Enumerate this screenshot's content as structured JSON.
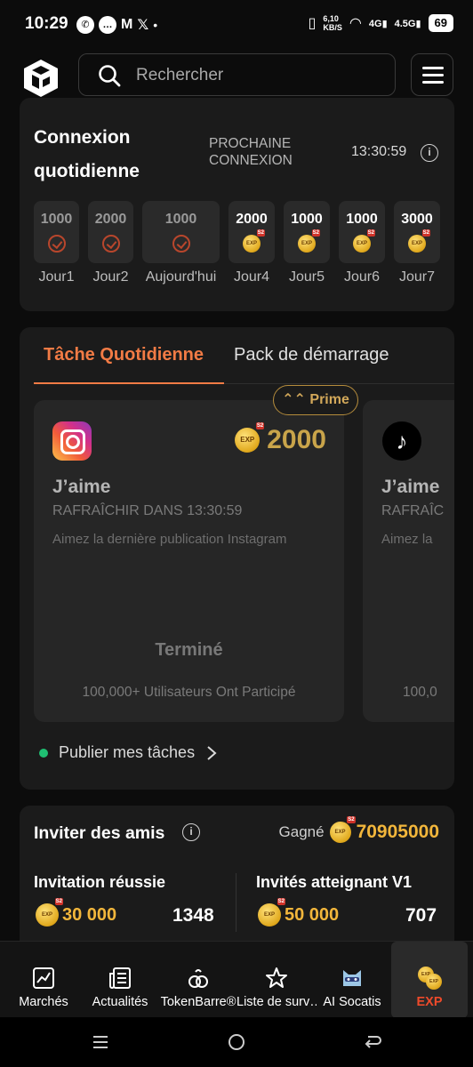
{
  "status": {
    "time": "10:29",
    "net_speed": "6,10\nKB/S",
    "battery": "69"
  },
  "header": {
    "search_placeholder": "Rechercher"
  },
  "checkin": {
    "title": "Connexion quotidienne",
    "next_label": "PROCHAINE CONNEXION",
    "timer": "13:30:59",
    "days": [
      {
        "amount": "1000",
        "label": "Jour1",
        "state": "done"
      },
      {
        "amount": "2000",
        "label": "Jour2",
        "state": "done"
      },
      {
        "amount": "1000",
        "label": "Aujourd'hui",
        "state": "done"
      },
      {
        "amount": "2000",
        "label": "Jour4",
        "state": "pending"
      },
      {
        "amount": "1000",
        "label": "Jour5",
        "state": "pending"
      },
      {
        "amount": "1000",
        "label": "Jour6",
        "state": "pending"
      },
      {
        "amount": "3000",
        "label": "Jour7",
        "state": "pending"
      }
    ]
  },
  "tasks": {
    "tab_active": "Tâche Quotidienne",
    "tab_other": "Pack de démarrage",
    "prime_label": "Prime",
    "task1": {
      "reward": "2000",
      "title": "J’aime",
      "refresh": "RAFRAÎCHIR DANS 13:30:59",
      "desc": "Aimez la dernière publication Instagram",
      "status": "Terminé",
      "participants": "100,000+ Utilisateurs Ont Participé"
    },
    "task2": {
      "title": "J’aime",
      "refresh": "RAFRAÎC",
      "desc": "Aimez la",
      "participants": "100,0"
    },
    "publish_label": "Publier mes tâches"
  },
  "invite": {
    "title": "Inviter des amis",
    "earned_label": "Gagné",
    "earned_value": "70905000",
    "col1_title": "Invitation réussie",
    "col1_reward": "30 000",
    "col1_count": "1348",
    "col2_title": "Invités atteignant V1",
    "col2_reward": "50 000",
    "col2_count": "707"
  },
  "bottom_nav": [
    {
      "label": "Marchés",
      "icon": "chart-icon"
    },
    {
      "label": "Actualités",
      "icon": "news-icon"
    },
    {
      "label": "TokenBarre®",
      "icon": "tokenbar-icon"
    },
    {
      "label": "Liste de surv…",
      "icon": "star-icon"
    },
    {
      "label": "AI Socatis",
      "icon": "cat-icon"
    },
    {
      "label": "EXP",
      "icon": "exp-coins-icon"
    }
  ],
  "colors": {
    "accent": "#f27b45",
    "gold": "#f2b63b",
    "nav_active": "#ee4a2a"
  }
}
